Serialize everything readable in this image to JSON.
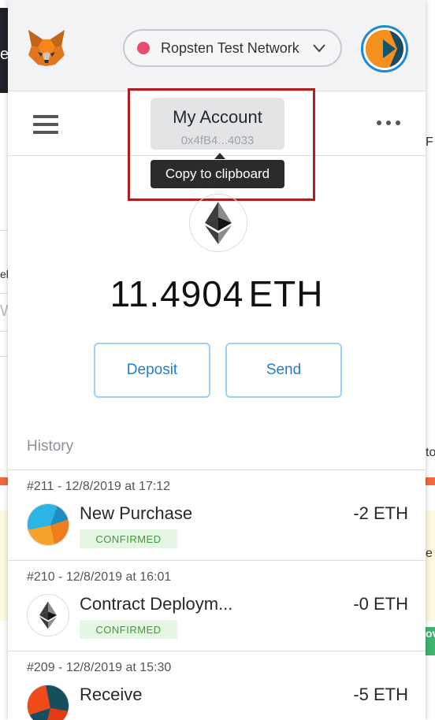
{
  "background": {
    "left_letter": "e",
    "left_fragments": [
      "eb",
      "W"
    ],
    "right_fragments": [
      "F",
      "to",
      "e",
      "ov"
    ]
  },
  "header": {
    "network_label": "Ropsten Test Network",
    "network_status_color": "#e94b6f"
  },
  "account": {
    "name": "My Account",
    "address": "0x4fB4...4033",
    "tooltip": "Copy to clipboard"
  },
  "balance": {
    "amount": "11.4904",
    "unit": "ETH"
  },
  "actions": {
    "deposit_label": "Deposit",
    "send_label": "Send"
  },
  "history": {
    "title": "History",
    "transactions": [
      {
        "meta": "#211 - 12/8/2019 at 17:12",
        "title": "New Purchase",
        "amount": "-2 ETH",
        "status": "CONFIRMED",
        "icon": "identicon"
      },
      {
        "meta": "#210 - 12/8/2019 at 16:01",
        "title": "Contract Deploym...",
        "amount": "-0 ETH",
        "status": "CONFIRMED",
        "icon": "ethereum-icon"
      },
      {
        "meta": "#209 - 12/8/2019 at 15:30",
        "title": "Receive",
        "amount": "-5 ETH",
        "status": "",
        "icon": "identicon"
      }
    ]
  },
  "colors": {
    "accent": "#1f7ed0",
    "highlight": "#b01e22",
    "confirmed_bg": "#e6f6e4",
    "confirmed_text": "#3c9a3c"
  }
}
